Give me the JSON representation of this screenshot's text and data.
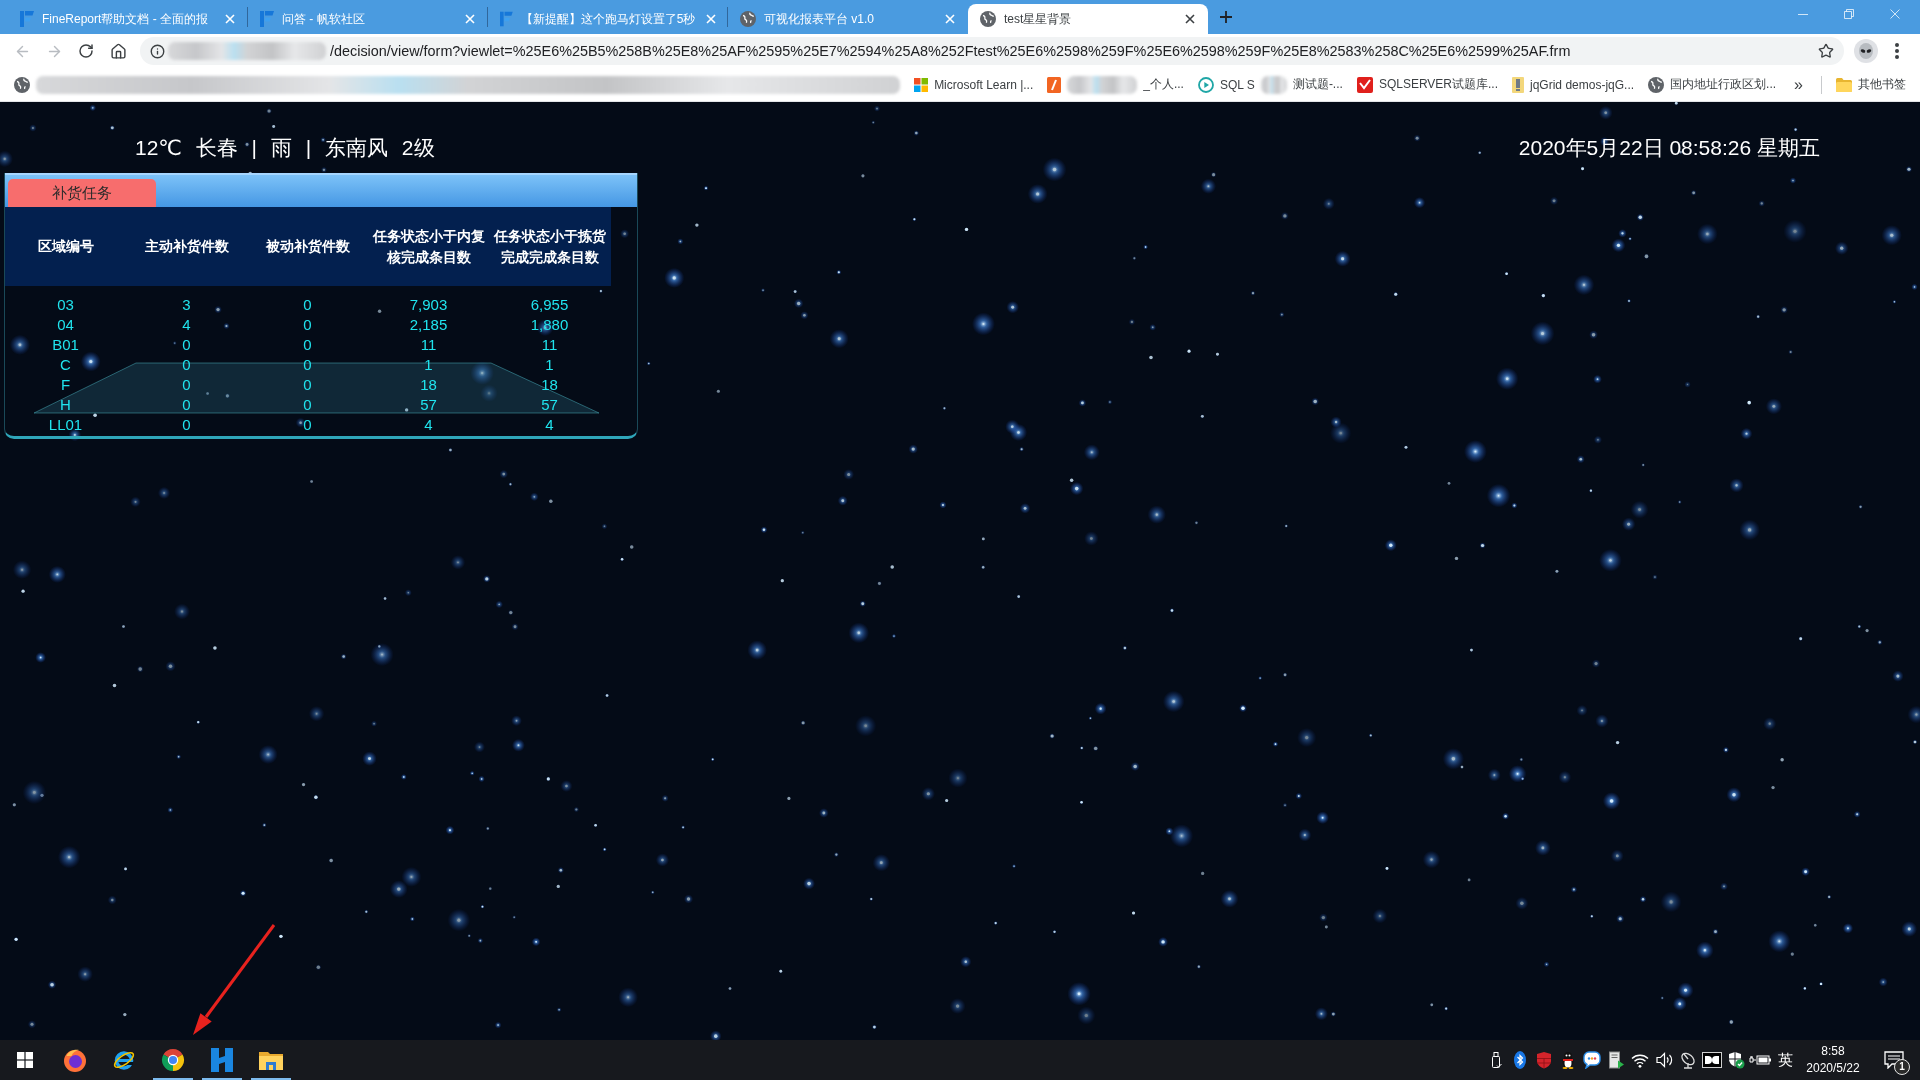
{
  "browser": {
    "tabs": [
      {
        "kind": "logo",
        "title": "FineReport帮助文档 - 全面的报",
        "selected": false
      },
      {
        "kind": "logo",
        "title": "问答 - 帆软社区",
        "selected": false
      },
      {
        "kind": "logo",
        "title": "【新提醒】这个跑马灯设置了5秒",
        "selected": false
      },
      {
        "kind": "globe",
        "title": "可视化报表平台 v1.0",
        "selected": false
      },
      {
        "kind": "globe",
        "title": "test星星背景",
        "selected": true
      }
    ],
    "toolbar": {
      "back_disabled": true,
      "forward_disabled": true,
      "url": "/decision/view/form?viewlet=%25E6%25B5%258B%25E8%25AF%2595%25E7%2594%25A8%252Ftest%25E6%2598%259F%25E6%2598%259F%25E8%2583%258C%25E6%2599%25AF.frm"
    },
    "bookmarks": [
      {
        "kind": "globe",
        "segments": [
          {
            "kind": "blur"
          }
        ]
      },
      {
        "kind": "tiles",
        "segments": [
          {
            "kind": "text",
            "text": "Microsoft Learn |..."
          }
        ]
      },
      {
        "kind": "note",
        "segments": [
          {
            "kind": "blur"
          },
          {
            "kind": "text",
            "text": "_个人..."
          }
        ]
      },
      {
        "kind": "play",
        "segments": [
          {
            "kind": "text",
            "text": "SQL S"
          },
          {
            "kind": "blur"
          },
          {
            "kind": "text",
            "text": "测试题-..."
          }
        ]
      },
      {
        "kind": "swoosh",
        "segments": [
          {
            "kind": "text",
            "text": "SQLSERVER试题库..."
          }
        ]
      },
      {
        "kind": "document",
        "segments": [
          {
            "kind": "text",
            "text": "jqGrid demos-jqG..."
          }
        ]
      },
      {
        "kind": "globe",
        "segments": [
          {
            "kind": "text",
            "text": "国内地址行政区划..."
          }
        ]
      }
    ],
    "more_bookmarks": "»",
    "other_bookmarks": "其他书签"
  },
  "page": {
    "weather": "12℃ 长春 | 雨 | 东南风 2级",
    "datetime": "2020年5月22日 08:58:26 星期五",
    "panel": {
      "tabs": [
        {
          "label": "补货任务",
          "selected": true
        }
      ],
      "columns": [
        "区域编号",
        "主动补货件数",
        "被动补货件数",
        "任务状态小于内复核完成条目数",
        "任务状态小于拣货完成完成条目数"
      ],
      "rows": [
        [
          "03",
          "3",
          "0",
          "7,903",
          "6,955"
        ],
        [
          "04",
          "4",
          "0",
          "2,185",
          "1,880"
        ],
        [
          "B01",
          "0",
          "0",
          "11",
          "11"
        ],
        [
          "C",
          "0",
          "0",
          "1",
          "1"
        ],
        [
          "F",
          "0",
          "0",
          "18",
          "18"
        ],
        [
          "H",
          "0",
          "0",
          "57",
          "57"
        ],
        [
          "LL01",
          "0",
          "0",
          "4",
          "4"
        ]
      ]
    }
  },
  "taskbar": {
    "apps": [
      {
        "kind": "fox",
        "running": false
      },
      {
        "kind": "orbit",
        "running": false
      },
      {
        "kind": "wheel",
        "running": true
      },
      {
        "kind": "block",
        "running": true
      },
      {
        "kind": "folder",
        "running": true
      }
    ],
    "tray": {
      "input_method": "英",
      "time": "8:58",
      "date": "2020/5/22",
      "notification_count": "1"
    }
  }
}
